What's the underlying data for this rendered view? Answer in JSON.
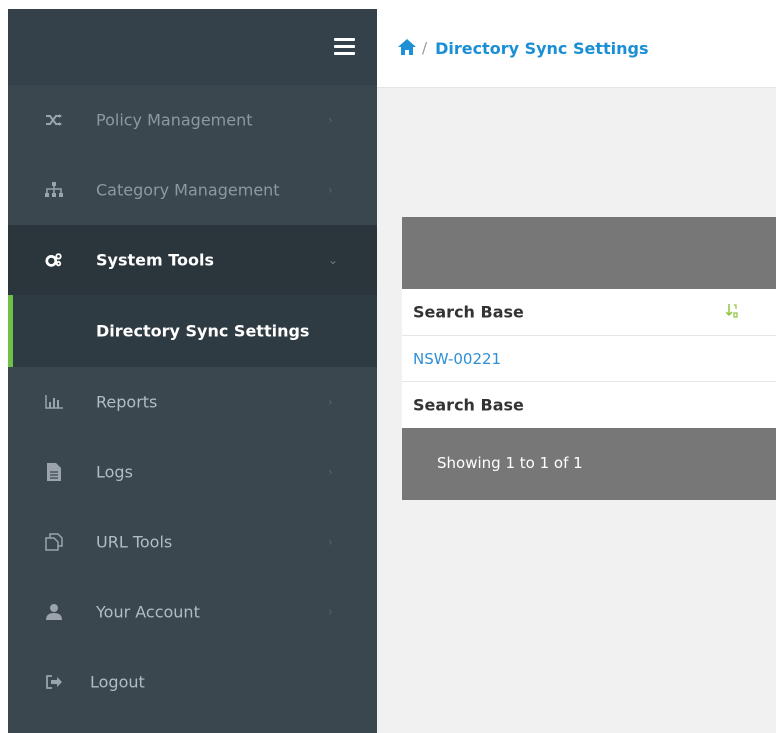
{
  "breadcrumb": {
    "current": "Directory Sync Settings"
  },
  "sidebar": {
    "items": [
      {
        "label": "Policy Management",
        "icon": "shuffle-icon"
      },
      {
        "label": "Category Management",
        "icon": "sitemap-icon"
      },
      {
        "label": "System Tools",
        "icon": "cogs-icon"
      },
      {
        "label": "Directory Sync Settings"
      },
      {
        "label": "Reports",
        "icon": "bar-chart-icon"
      },
      {
        "label": "Logs",
        "icon": "file-icon"
      },
      {
        "label": "URL Tools",
        "icon": "copy-icon"
      },
      {
        "label": "Your Account",
        "icon": "user-icon"
      },
      {
        "label": "Logout",
        "icon": "sign-out-icon"
      }
    ]
  },
  "table": {
    "header": "Search Base",
    "rows": [
      "NSW-00221"
    ],
    "footer_header": "Search Base",
    "showing": "Showing 1 to 1 of 1"
  },
  "colors": {
    "accent": "#1a8fd6",
    "sidebar_bg": "#3a474e",
    "active_marker": "#6fbf4a"
  }
}
